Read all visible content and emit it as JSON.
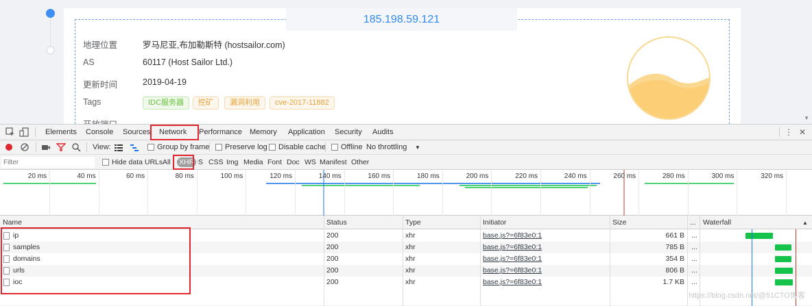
{
  "page": {
    "ip": "185.198.59.121",
    "info": [
      {
        "label": "地理位置",
        "value": "罗马尼亚,布加勒斯特 (hostsailor.com)"
      },
      {
        "label": "AS",
        "value": "60117 (Host Sailor Ltd.)"
      },
      {
        "label": "更新时间",
        "value": "2019-04-19"
      },
      {
        "label": "Tags",
        "value": ""
      },
      {
        "label": "开放端口",
        "value": ""
      }
    ],
    "tags": [
      {
        "text": "IDC服务器",
        "color": "green"
      },
      {
        "text": "挖矿",
        "color": "orange"
      },
      {
        "text": "漏洞利用",
        "color": "orange"
      },
      {
        "text": "cve-2017-11882",
        "color": "orange"
      }
    ]
  },
  "devtools": {
    "tabs": [
      "Elements",
      "Console",
      "Sources",
      "Network",
      "Performance",
      "Memory",
      "Application",
      "Security",
      "Audits"
    ],
    "selected_tab": "Network",
    "toolbar": {
      "view_label": "View:",
      "group_by_frame": "Group by frame",
      "preserve_log": "Preserve log",
      "disable_cache": "Disable cache",
      "offline": "Offline",
      "throttling": "No throttling"
    },
    "filter": {
      "placeholder": "Filter",
      "hide_data_urls": "Hide data URLs",
      "types": [
        "All",
        "XHR",
        "JS",
        "CSS",
        "Img",
        "Media",
        "Font",
        "Doc",
        "WS",
        "Manifest",
        "Other"
      ],
      "selected_type": "XHR"
    },
    "overview_ticks": [
      "20 ms",
      "40 ms",
      "60 ms",
      "80 ms",
      "100 ms",
      "120 ms",
      "140 ms",
      "160 ms",
      "180 ms",
      "200 ms",
      "220 ms",
      "240 ms",
      "260 ms",
      "280 ms",
      "300 ms",
      "320 ms"
    ],
    "columns": {
      "name": "Name",
      "status": "Status",
      "type": "Type",
      "initiator": "Initiator",
      "size": "Size",
      "more": "...",
      "waterfall": "Waterfall"
    },
    "requests": [
      {
        "name": "ip",
        "status": "200",
        "type": "xhr",
        "initiator": "base.js?=6f83e0:1",
        "size": "661 B",
        "more": "..."
      },
      {
        "name": "samples",
        "status": "200",
        "type": "xhr",
        "initiator": "base.js?=6f83e0:1",
        "size": "785 B",
        "more": "..."
      },
      {
        "name": "domains",
        "status": "200",
        "type": "xhr",
        "initiator": "base.js?=6f83e0:1",
        "size": "354 B",
        "more": "..."
      },
      {
        "name": "urls",
        "status": "200",
        "type": "xhr",
        "initiator": "base.js?=6f83e0:1",
        "size": "806 B",
        "more": "..."
      },
      {
        "name": "ioc",
        "status": "200",
        "type": "xhr",
        "initiator": "base.js?=6f83e0:1",
        "size": "1.7 KB",
        "more": "..."
      }
    ]
  },
  "watermark": "https://blog.csdn.net/@51CTO博客",
  "colors": {
    "accent": "#1a73e8",
    "highlight": "#e0262e",
    "bar": "#15c34a"
  }
}
